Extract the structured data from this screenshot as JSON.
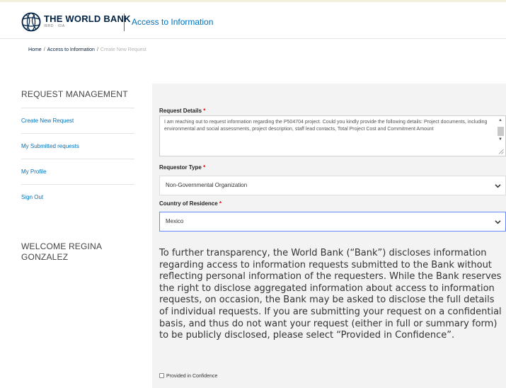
{
  "header": {
    "brand_name": "THE WORLD BANK",
    "brand_sub": "IBRD · IDA",
    "section_title": "Access to Information"
  },
  "breadcrumb": {
    "items": [
      "Home",
      "Access to Information"
    ],
    "current": "Create New Request",
    "separator": "/"
  },
  "sidebar": {
    "title": "REQUEST MANAGEMENT",
    "items": [
      {
        "label": "Create New Request"
      },
      {
        "label": "My Submitted requests"
      },
      {
        "label": "My Profile"
      },
      {
        "label": "Sign Out"
      }
    ],
    "welcome": "WELCOME REGINA GONZALEZ"
  },
  "form": {
    "request_details": {
      "label": "Request Details",
      "required_mark": "*",
      "value": "I am reaching out to request information regarding the P504704 project. Could you kindly provide the following details: Project documents, including environmental and social assessments, project description, staff lead contacts, Total Project Cost and Commitment Amount"
    },
    "requestor_type": {
      "label": "Requestor Type",
      "required_mark": "*",
      "value": "Non-Governmental Organization"
    },
    "country": {
      "label": "Country of Residence",
      "required_mark": "*",
      "value": "Mexico"
    },
    "disclosure_text": "To further transparency, the World Bank (“Bank”) discloses information regarding access to information requests submitted to the Bank without reflecting personal information of the requesters. While the Bank reserves the right to disclose aggregated information about access to information requests, on occasion, the Bank may be asked to disclose the full details of individual requests. If you are submitting your request on a confidential basis, and thus do not want your request (either in full or summary form) to be publicly disclosed, please select “Provided in Confidence”.",
    "confidential_checkbox": {
      "label": "Provided in Confidence",
      "checked": false
    }
  },
  "colors": {
    "link": "#0071bc",
    "brand_navy": "#002244",
    "required": "#e00000",
    "panel_bg": "#f3f3f3",
    "focus_border": "#6b87ff"
  },
  "icons": {
    "logo": "world-bank-globe-icon",
    "select_arrow": "chevron-down-icon",
    "textarea_resize": "resize-handle-icon"
  }
}
